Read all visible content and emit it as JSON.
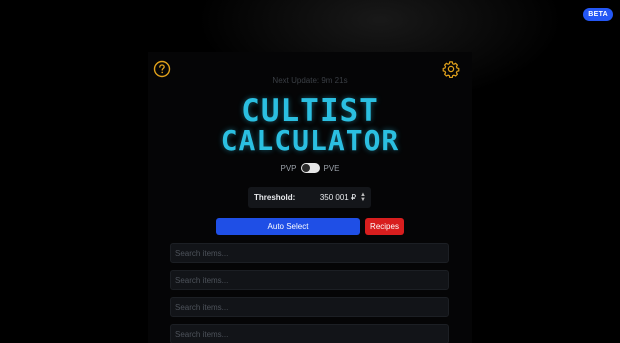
{
  "badge": {
    "label": "BETA",
    "color": "#2457f5"
  },
  "header": {
    "help_icon": "help-circle-icon",
    "settings_icon": "gear-icon",
    "accent_color": "#e0a11b",
    "next_update": "Next Update: 9m 21s"
  },
  "logo": {
    "line1": "CULTIST",
    "line2": "CALCULATOR",
    "color": "#2bbfe1"
  },
  "mode": {
    "left_label": "PVP",
    "right_label": "PVE",
    "selected": "PVP"
  },
  "threshold": {
    "label": "Threshold:",
    "value": "350 001 ₽"
  },
  "actions": {
    "auto_select": "Auto Select",
    "auto_select_color": "#1f4fe6",
    "recipes": "Recipes",
    "recipes_color": "#d81e1e"
  },
  "search_fields": [
    {
      "placeholder": "Search items..."
    },
    {
      "placeholder": "Search items..."
    },
    {
      "placeholder": "Search items..."
    },
    {
      "placeholder": "Search items..."
    }
  ]
}
